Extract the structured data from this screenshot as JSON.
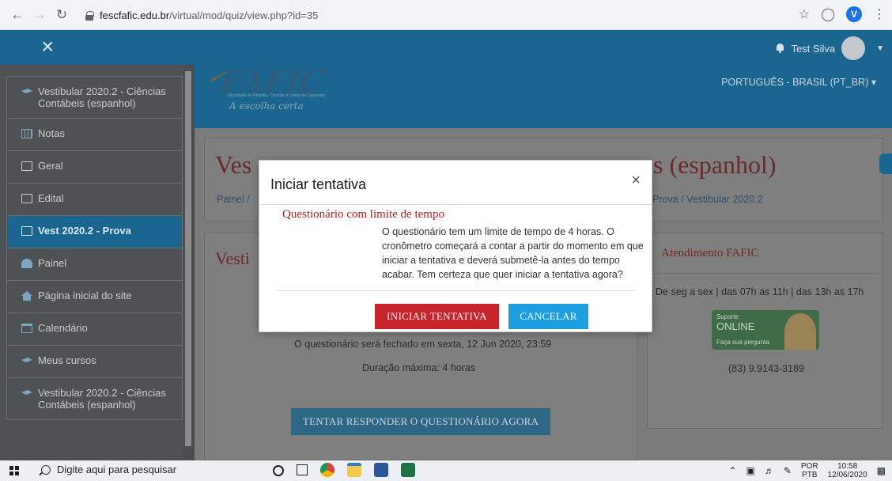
{
  "browser": {
    "url_host": "fescfafic.edu.br",
    "url_path": "/virtual/mod/quiz/view.php?id=35",
    "profile_initial": "V"
  },
  "topnav": {
    "close_glyph": "×",
    "user_name": "Test Silva"
  },
  "sidebar": {
    "items": [
      {
        "label": "Vestibular 2020.2 - Ciências Contábeis (espanhol)",
        "icon": "graduation-cap-icon"
      },
      {
        "label": "Notas",
        "icon": "table-icon"
      },
      {
        "label": "Geral",
        "icon": "folder-icon"
      },
      {
        "label": "Edital",
        "icon": "folder-icon"
      },
      {
        "label": "Vest 2020.2 - Prova",
        "icon": "folder-icon",
        "active": true
      },
      {
        "label": "Painel",
        "icon": "dashboard-icon"
      },
      {
        "label": "Página inicial do site",
        "icon": "home-icon"
      },
      {
        "label": "Calendário",
        "icon": "calendar-icon"
      },
      {
        "label": "Meus cursos",
        "icon": "graduation-cap-icon"
      },
      {
        "label": "Vestibular 2020.2 - Ciências Contábeis (espanhol)",
        "icon": "graduation-cap-icon"
      }
    ]
  },
  "banner": {
    "logo_text": "FAFIC",
    "logo_sub": "Faculdade de Filosofia, Ciências e Letras de Cajazeiras",
    "logo_slogan": "A escolha certa",
    "language": "PORTUGUÊS - BRASIL (PT_BR)"
  },
  "page": {
    "heading_left": "Ves",
    "heading_right": "s (espanhol)",
    "breadcrumb_left": "Painel  /",
    "breadcrumb_right": "Prova  /  Vestibular 2020.2",
    "quiz_heading": "Vesti",
    "close_date": "O questionário será fechado em sexta, 12 Jun 2020, 23:59",
    "duration": "Duração máxima: 4 horas",
    "attempt_button": "TENTAR RESPONDER O QUESTIONÁRIO AGORA"
  },
  "support": {
    "title": "Atendimento FAFIC",
    "hours": "De seg a sex | das 07h as 11h | das 13h as 17h",
    "badge_l1": "Suporte",
    "badge_l2": "ONLINE",
    "badge_l3": "Faça sua pergunta",
    "phone": "(83) 9.9143-3189"
  },
  "modal": {
    "title": "Iniciar tentativa",
    "close_glyph": "×",
    "subtitle": "Questionário com limite de tempo",
    "body": "O questionário tem um limite de tempo de 4 horas. O cronômetro começará a contar a partir do momento em que iniciar a tentativa e deverá submetê-la antes do tempo acabar. Tem certeza que quer iniciar a tentativa agora?",
    "start_label": "INICIAR TENTATIVA",
    "cancel_label": "CANCELAR"
  },
  "taskbar": {
    "search_placeholder": "Digite aqui para pesquisar",
    "lang_1": "POR",
    "lang_2": "PTB",
    "time": "10:58",
    "date": "12/06/2020"
  },
  "colors": {
    "primary": "#1a6690",
    "danger": "#c7242b",
    "info": "#1c9ee0",
    "title_red": "#b11f1f"
  }
}
